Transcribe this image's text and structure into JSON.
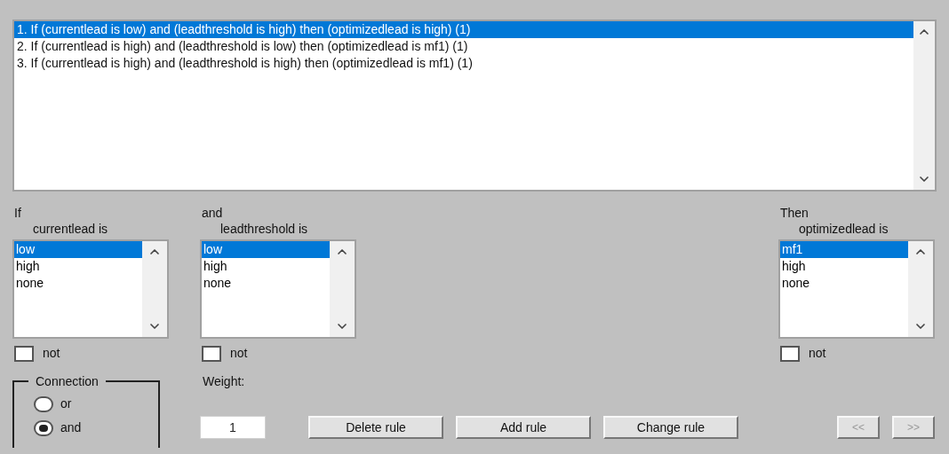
{
  "rules": [
    {
      "text": "1. If (currentlead is low) and (leadthreshold is high) then (optimizedlead is high) (1)",
      "selected": true
    },
    {
      "text": "2. If (currentlead is high) and (leadthreshold is low) then (optimizedlead is mf1) (1)",
      "selected": false
    },
    {
      "text": "3. If (currentlead is high) and (leadthreshold is high) then (optimizedlead is mf1) (1)",
      "selected": false
    }
  ],
  "variables": [
    {
      "heading": "If",
      "name_label": "currentlead is",
      "items": [
        {
          "label": "low",
          "selected": true
        },
        {
          "label": "high",
          "selected": false
        },
        {
          "label": "none",
          "selected": false
        }
      ],
      "not_label": "not",
      "not_checked": false
    },
    {
      "heading": "and",
      "name_label": "leadthreshold is",
      "items": [
        {
          "label": "low",
          "selected": true
        },
        {
          "label": "high",
          "selected": false
        },
        {
          "label": "none",
          "selected": false
        }
      ],
      "not_label": "not",
      "not_checked": false
    },
    {
      "heading": "Then",
      "name_label": "optimizedlead is",
      "items": [
        {
          "label": "mf1",
          "selected": true
        },
        {
          "label": "high",
          "selected": false
        },
        {
          "label": "none",
          "selected": false
        }
      ],
      "not_label": "not",
      "not_checked": false
    }
  ],
  "connection": {
    "title": "Connection",
    "options": [
      {
        "label": "or",
        "selected": false
      },
      {
        "label": "and",
        "selected": true
      }
    ]
  },
  "weight": {
    "label": "Weight:",
    "value": "1"
  },
  "buttons": [
    {
      "label": "Delete rule",
      "disabled": false
    },
    {
      "label": "Add rule",
      "disabled": false
    },
    {
      "label": "Change rule",
      "disabled": false
    }
  ],
  "nav_buttons": [
    {
      "label": "<<",
      "disabled": true
    },
    {
      "label": ">>",
      "disabled": true
    }
  ]
}
